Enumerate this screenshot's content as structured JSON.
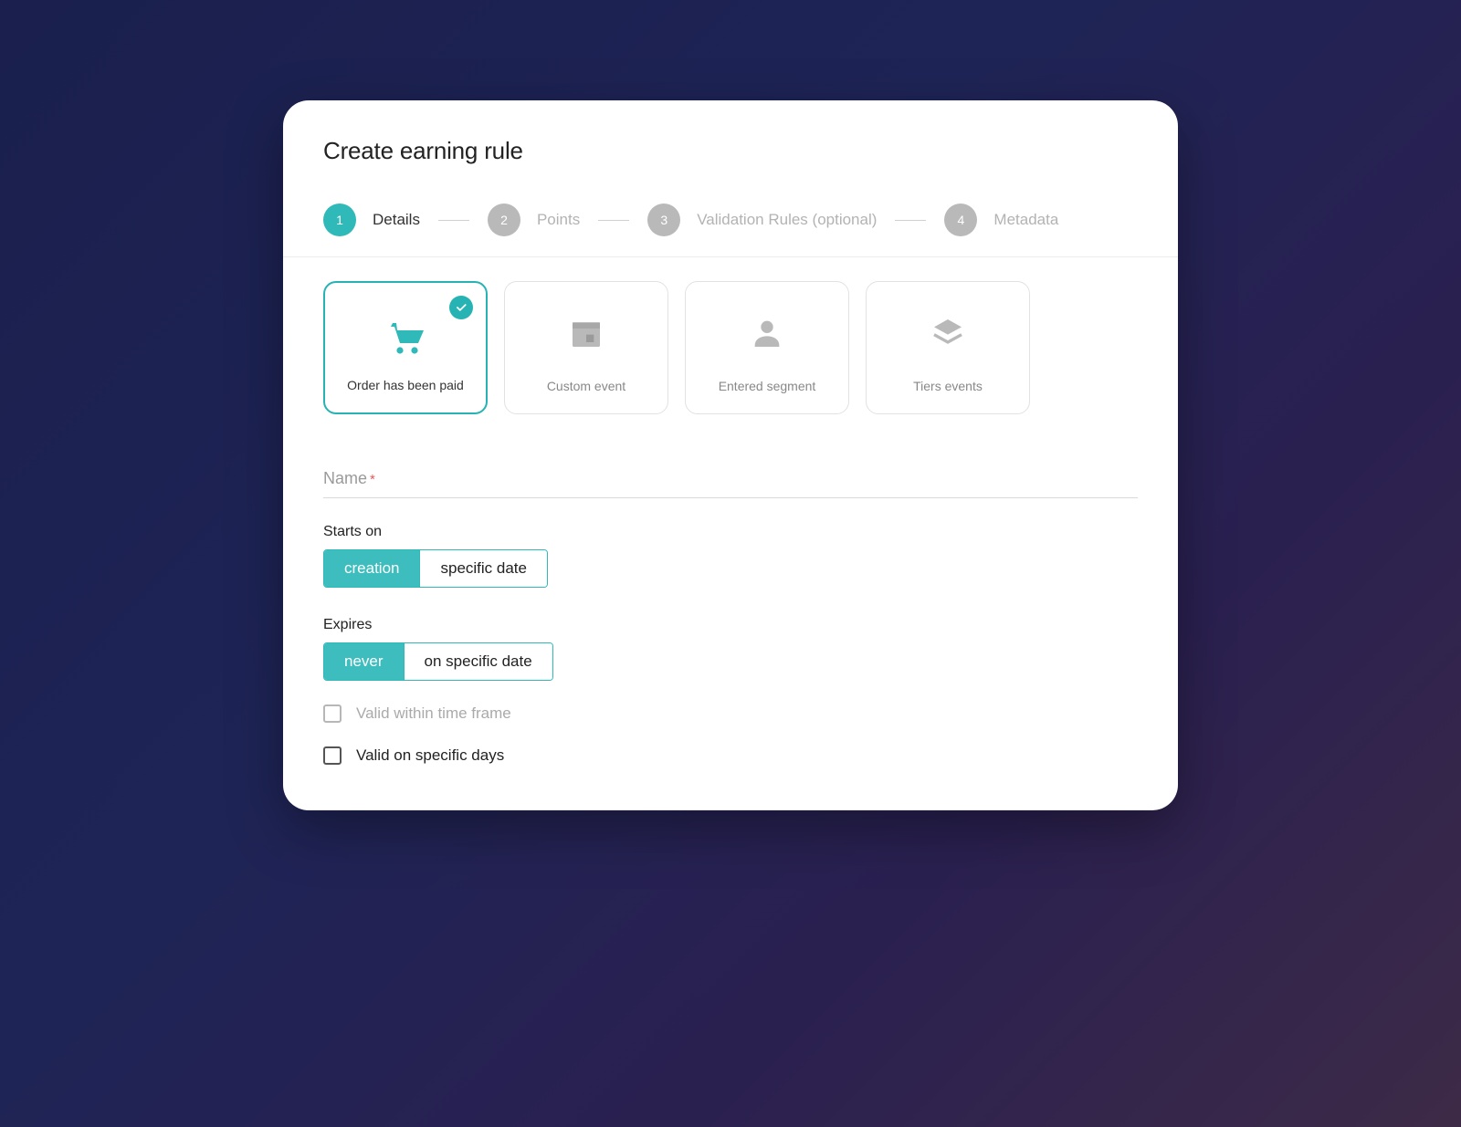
{
  "title": "Create earning rule",
  "steps": [
    {
      "num": "1",
      "label": "Details",
      "active": true
    },
    {
      "num": "2",
      "label": "Points",
      "active": false
    },
    {
      "num": "3",
      "label": "Validation Rules (optional)",
      "active": false
    },
    {
      "num": "4",
      "label": "Metadata",
      "active": false
    }
  ],
  "typeCards": [
    {
      "label": "Order has been paid",
      "selected": true,
      "icon": "cart"
    },
    {
      "label": "Custom event",
      "selected": false,
      "icon": "calendar"
    },
    {
      "label": "Entered segment",
      "selected": false,
      "icon": "person"
    },
    {
      "label": "Tiers events",
      "selected": false,
      "icon": "layers"
    }
  ],
  "nameField": {
    "label": "Name",
    "required": "*"
  },
  "startsOn": {
    "label": "Starts on",
    "options": [
      "creation",
      "specific date"
    ],
    "active": 0
  },
  "expires": {
    "label": "Expires",
    "options": [
      "never",
      "on specific date"
    ],
    "active": 0
  },
  "checks": [
    {
      "label": "Valid within time frame",
      "muted": true
    },
    {
      "label": "Valid on specific days",
      "muted": false
    }
  ]
}
